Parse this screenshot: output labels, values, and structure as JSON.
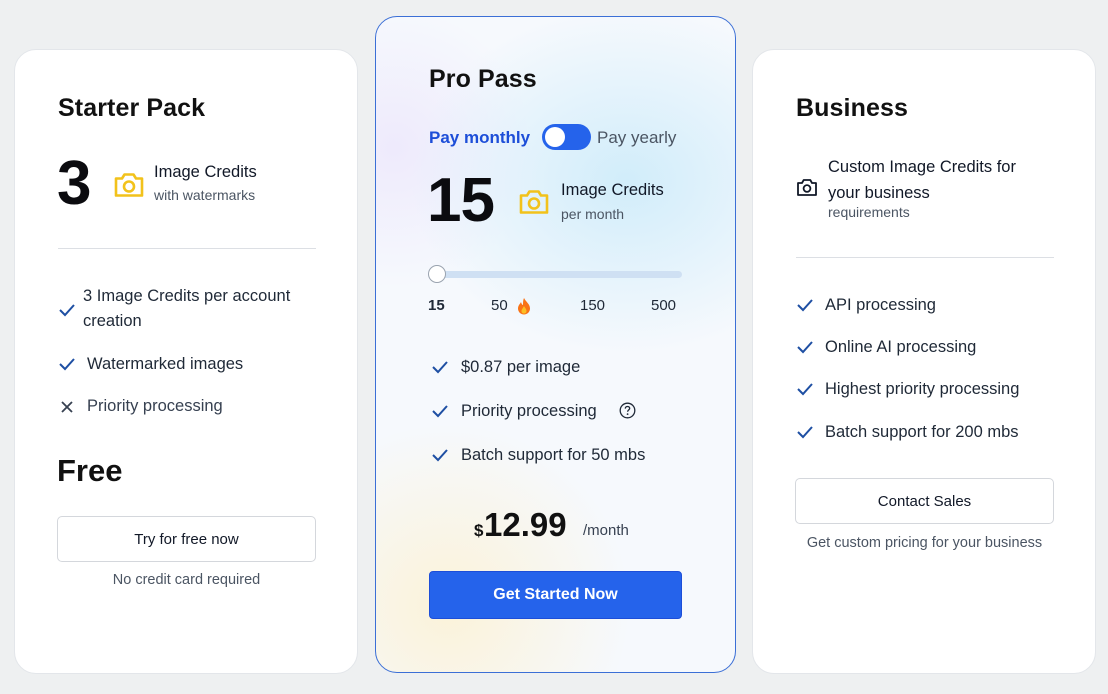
{
  "starter": {
    "title": "Starter Pack",
    "credits_number": "3",
    "credits_label": "Image Credits",
    "credits_sub": "with watermarks",
    "features": [
      {
        "text_line1": "3 Image Credits per account",
        "text_line2": "creation",
        "included": true
      },
      {
        "text": "Watermarked images",
        "included": true
      },
      {
        "text": "Priority processing",
        "included": false
      }
    ],
    "price": "Free",
    "button_label": "Try for free now",
    "note": "No credit card required"
  },
  "pro": {
    "title": "Pro Pass",
    "toggle_left": "Pay monthly",
    "toggle_right": "Pay yearly",
    "credits_number": "15",
    "credits_label": "Image Credits",
    "credits_sub": "per month",
    "slider_ticks": [
      "15",
      "50",
      "150",
      "500"
    ],
    "slider_selected": "15",
    "features": [
      {
        "text": "$0.87 per image",
        "included": true
      },
      {
        "text": "Priority processing",
        "included": true,
        "help": true
      },
      {
        "text": "Batch support for 50 mbs",
        "included": true
      }
    ],
    "currency": "$",
    "price": "12.99",
    "period": "/month",
    "button_label": "Get Started Now"
  },
  "business": {
    "title": "Business",
    "credits_label_line1": "Custom Image Credits for",
    "credits_label_line2": "your business",
    "credits_sub": "requirements",
    "features": [
      {
        "text": "API processing",
        "included": true
      },
      {
        "text": "Online AI processing",
        "included": true
      },
      {
        "text": "Highest priority processing",
        "included": true
      },
      {
        "text": "Batch support for 200 mbs",
        "included": true
      }
    ],
    "button_label": "Contact Sales",
    "note": "Get custom pricing for your business"
  },
  "colors": {
    "accent_blue": "#2563eb",
    "camera_yellow": "#f2c21b",
    "check_blue": "#1e4fa3"
  },
  "icons": [
    "camera-icon",
    "check-icon",
    "close-icon",
    "fire-icon",
    "help-circle-icon"
  ]
}
